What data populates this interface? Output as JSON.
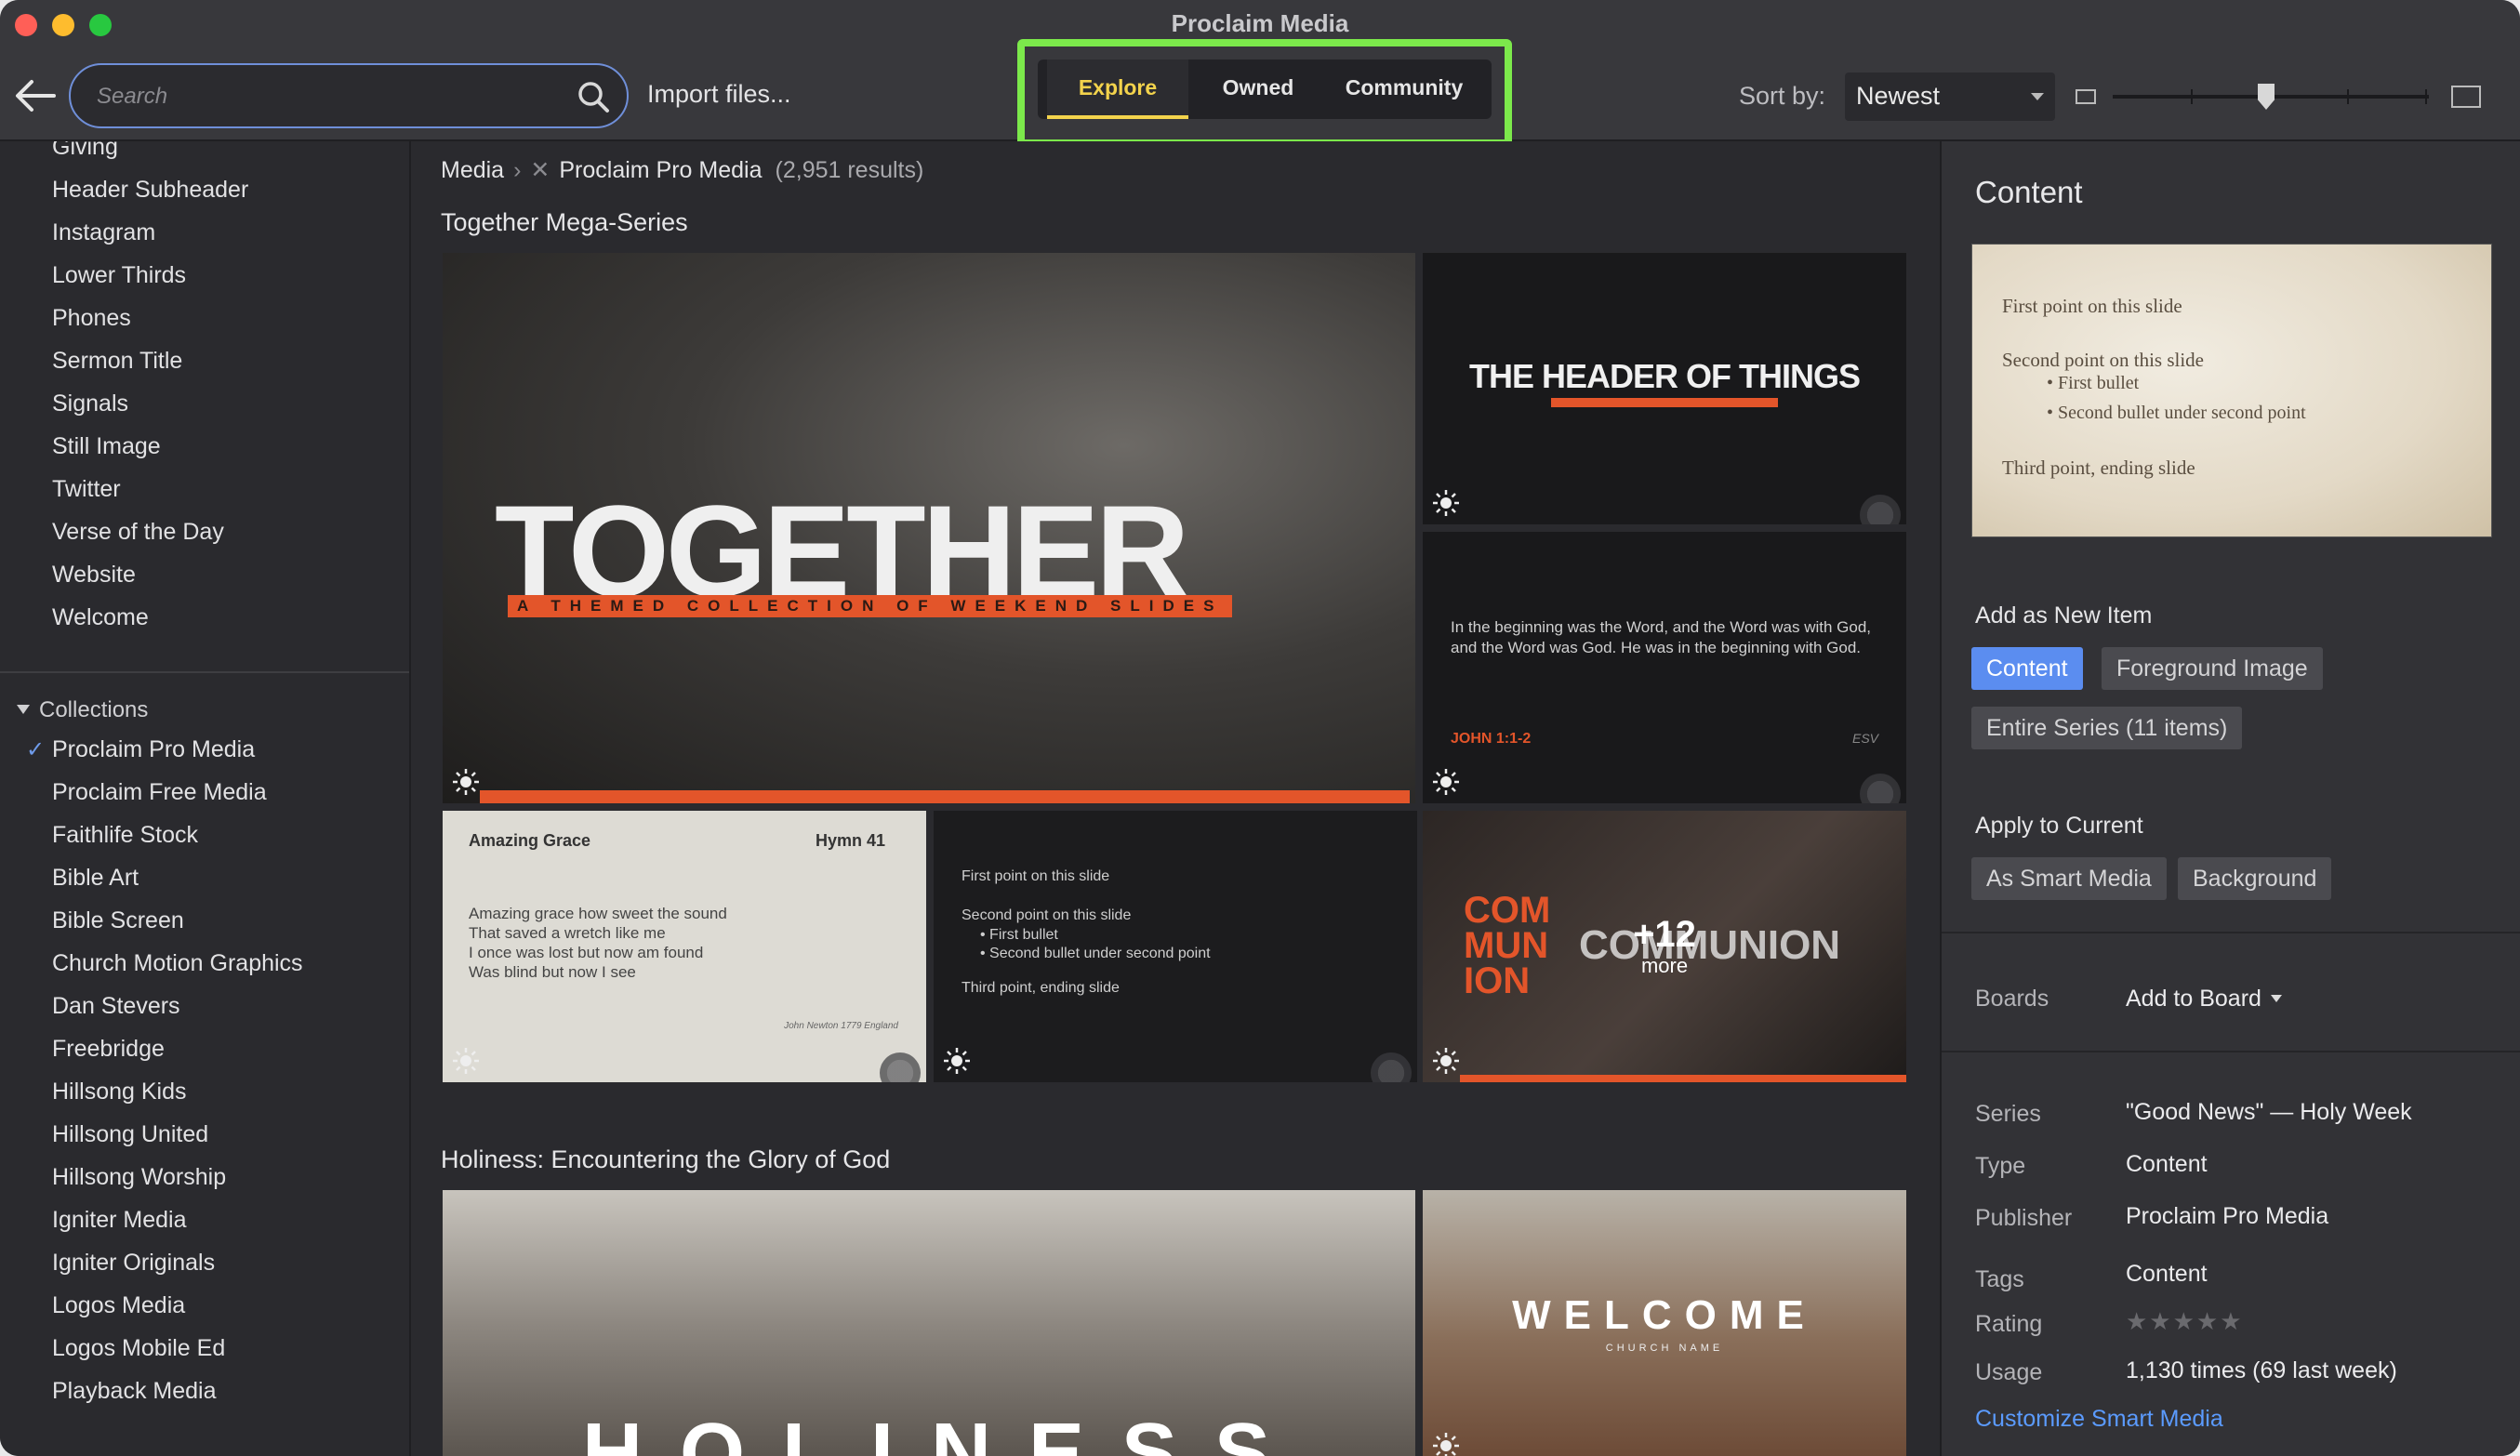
{
  "window": {
    "title": "Proclaim Media"
  },
  "toolbar": {
    "search_placeholder": "Search",
    "import_label": "Import files...",
    "tabs": [
      {
        "label": "Explore",
        "active": true
      },
      {
        "label": "Owned",
        "active": false
      },
      {
        "label": "Community",
        "active": false
      }
    ],
    "sort_label": "Sort by:",
    "sort_value": "Newest"
  },
  "sidebar": {
    "categories": [
      "Giving",
      "Header Subheader",
      "Instagram",
      "Lower Thirds",
      "Phones",
      "Sermon Title",
      "Signals",
      "Still Image",
      "Twitter",
      "Verse of the Day",
      "Website",
      "Welcome"
    ],
    "collections_label": "Collections",
    "collections": [
      {
        "label": "Proclaim Pro Media",
        "checked": true
      },
      {
        "label": "Proclaim Free Media"
      },
      {
        "label": "Faithlife Stock"
      },
      {
        "label": "Bible Art"
      },
      {
        "label": "Bible Screen"
      },
      {
        "label": "Church Motion Graphics"
      },
      {
        "label": "Dan Stevers"
      },
      {
        "label": "Freebridge"
      },
      {
        "label": "Hillsong Kids"
      },
      {
        "label": "Hillsong United"
      },
      {
        "label": "Hillsong Worship"
      },
      {
        "label": "Igniter Media"
      },
      {
        "label": "Igniter Originals"
      },
      {
        "label": "Logos Media"
      },
      {
        "label": "Logos Mobile Ed"
      },
      {
        "label": "Playback Media"
      }
    ]
  },
  "main": {
    "breadcrumb": {
      "root": "Media",
      "filter": "Proclaim Pro Media",
      "count": "(2,951 results)"
    },
    "sections": [
      {
        "title": "Together Mega-Series"
      },
      {
        "title": "Holiness: Encountering the Glory of God"
      }
    ],
    "thumbs": {
      "together": {
        "word": "TOGETHER",
        "sub": "A THEMED COLLECTION OF WEEKEND SLIDES"
      },
      "header": {
        "word": "THE HEADER OF THINGS"
      },
      "john": {
        "text": "In the beginning was the Word, and the Word was with God, and the Word was God.  He was in the beginning with God.",
        "ref": "JOHN 1:1-2",
        "version": "ESV"
      },
      "grace": {
        "title": "Amazing Grace",
        "hymn": "Hymn 41",
        "lines": [
          "Amazing grace how sweet the sound",
          "That saved a wretch like me",
          "I once was lost but now am found",
          "Was blind but now I see"
        ],
        "credit": "John Newton 1779 England"
      },
      "points": {
        "p1": "First point on this slide",
        "p2": "Second point on this slide",
        "b1": "First bullet",
        "b2": "Second bullet under second point",
        "p3": "Third point, ending slide"
      },
      "communion": {
        "left": "COM MUN ION",
        "mid": "COMMUNION",
        "more_count": "+12",
        "more_label": "more"
      },
      "holiness": {
        "word": "HOLINESS"
      },
      "welcome": {
        "word": "WELCOME",
        "sub": "CHURCH NAME"
      }
    }
  },
  "panel": {
    "title": "Content",
    "preview": {
      "p1": "First point on this slide",
      "p2": "Second point on this slide",
      "b1": "First bullet",
      "b2": "Second bullet under second point",
      "p3": "Third point, ending slide"
    },
    "add_new_label": "Add as New Item",
    "add_new": [
      "Content",
      "Foreground Image",
      "Entire Series (11 items)"
    ],
    "apply_label": "Apply to Current",
    "apply": [
      "As Smart Media",
      "Background"
    ],
    "boards_label": "Boards",
    "add_to_board": "Add to Board",
    "meta": {
      "series_label": "Series",
      "series": "\"Good News\" — Holy Week",
      "type_label": "Type",
      "type": "Content",
      "publisher_label": "Publisher",
      "publisher": "Proclaim Pro Media",
      "tags_label": "Tags",
      "tags": "Content",
      "rating_label": "Rating",
      "rating": "★★★★★",
      "usage_label": "Usage",
      "usage": "1,130 times (69 last week)"
    },
    "customize_link": "Customize Smart Media"
  },
  "colors": {
    "accent_blue": "#5b8df0",
    "tab_highlight": "#7ce94b",
    "active_tab": "#f3d34c",
    "brand_orange": "#e3552a"
  }
}
